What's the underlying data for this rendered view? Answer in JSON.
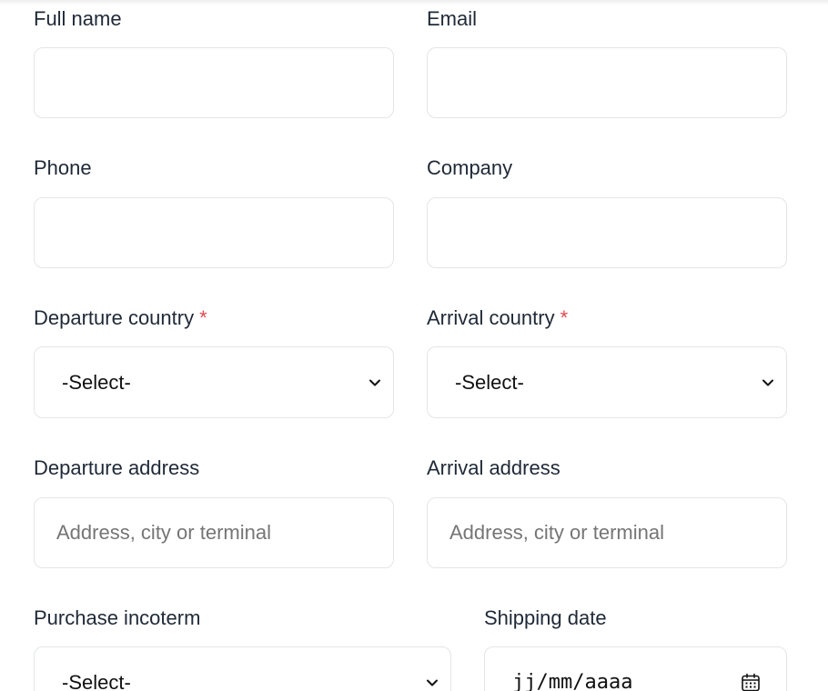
{
  "form": {
    "full_name": {
      "label": "Full name",
      "value": ""
    },
    "email": {
      "label": "Email",
      "value": ""
    },
    "phone": {
      "label": "Phone",
      "value": ""
    },
    "company": {
      "label": "Company",
      "value": ""
    },
    "departure_country": {
      "label": "Departure country",
      "required_mark": "*",
      "selected": "-Select-"
    },
    "arrival_country": {
      "label": "Arrival country",
      "required_mark": "*",
      "selected": "-Select-"
    },
    "departure_address": {
      "label": "Departure address",
      "placeholder": "Address, city or terminal",
      "value": ""
    },
    "arrival_address": {
      "label": "Arrival address",
      "placeholder": "Address, city or terminal",
      "value": ""
    },
    "purchase_incoterm": {
      "label": "Purchase incoterm",
      "selected": "-Select-"
    },
    "shipping_date": {
      "label": "Shipping date",
      "value": "jj/mm/aaaa",
      "icon": "calendar-icon"
    }
  },
  "colors": {
    "required": "#e0484f",
    "border": "#e3e5e8",
    "label": "#1f2937",
    "placeholder": "#757575"
  }
}
